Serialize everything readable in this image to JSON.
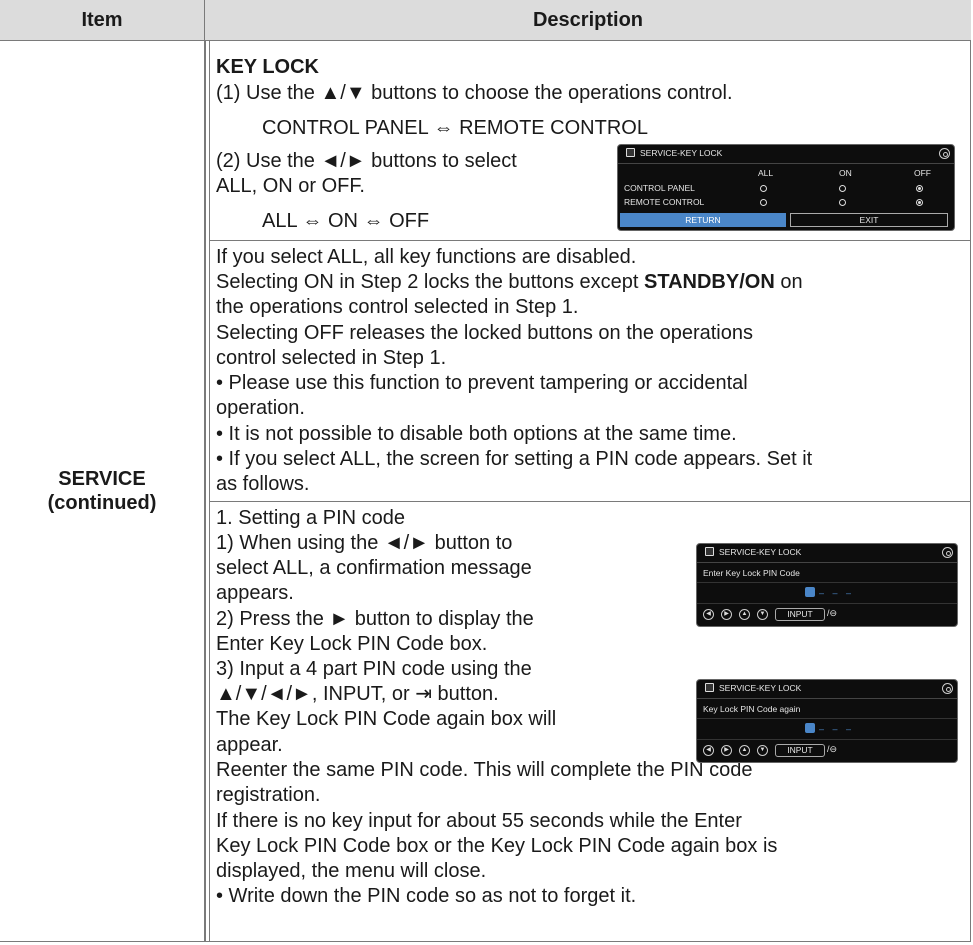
{
  "table": {
    "header_item": "Item",
    "header_description": "Description",
    "item_line1": "SERVICE",
    "item_line2": "(continued)"
  },
  "key_lock": {
    "title": "KEY LOCK",
    "step1": "(1) Use the ▲/▼ buttons to choose the operations control.",
    "step1_options": "CONTROL PANEL ⇔ REMOTE CONTROL",
    "step2_line1": "(2) Use the ◄/► buttons to select",
    "step2_line2": "ALL, ON or OFF.",
    "step2_options": "ALL ⇔ ON ⇔ OFF"
  },
  "screen1": {
    "title": "SERVICE-KEY LOCK",
    "col_all": "ALL",
    "col_on": "ON",
    "col_off": "OFF",
    "row1": "CONTROL PANEL",
    "row2": "REMOTE CONTROL",
    "return_label": "RETURN",
    "exit_label": "EXIT"
  },
  "notes": {
    "l1": "If you select ALL, all key functions are disabled.",
    "l2a": "Selecting ON in Step 2 locks the buttons except ",
    "l2b": "STANDBY/ON",
    "l2c": " on",
    "l3": "the operations control selected in Step 1.",
    "l4": "Selecting OFF releases the locked buttons on the operations",
    "l5": "control selected in Step 1.",
    "l6": "• Please use this function to prevent tampering or accidental",
    "l7": "operation.",
    "l8": "• It is not possible to disable both options at the same time.",
    "l9": "• If you select ALL, the screen for setting a PIN code appears. Set it",
    "l10": "as follows."
  },
  "pin": {
    "h": "1. Setting a PIN code",
    "s1a": "1) When using the ◄/► button to",
    "s1b": "select ALL, a confirmation message",
    "s1c": "appears.",
    "s2a": "2) Press the ► button to display the",
    "s2b": "Enter Key Lock PIN Code box.",
    "s3a": "3) Input a 4 part PIN code using the",
    "s3b": "▲/▼/◄/►, INPUT, or ⇥ button.",
    "s3c": "The Key Lock PIN Code again box will",
    "s3d": "appear.",
    "r1": "Reenter the same PIN code. This will complete the PIN code",
    "r2": "registration.",
    "r3": "If there is no key input for about 55 seconds while the Enter",
    "r4": "Key Lock PIN Code box or the Key Lock PIN Code again box is",
    "r5": "displayed, the menu will close.",
    "r6": "• Write down the PIN code so as not to forget it."
  },
  "screen2": {
    "title": "SERVICE-KEY LOCK",
    "prompt": "Enter Key Lock PIN Code",
    "input_label": "INPUT"
  },
  "screen3": {
    "title": "SERVICE-KEY LOCK",
    "prompt": "Key Lock PIN Code again",
    "input_label": "INPUT"
  },
  "colors": {
    "header_bg": "#dcdcdc",
    "screen_bg": "#0d0d0d",
    "highlight": "#4a86c8"
  }
}
